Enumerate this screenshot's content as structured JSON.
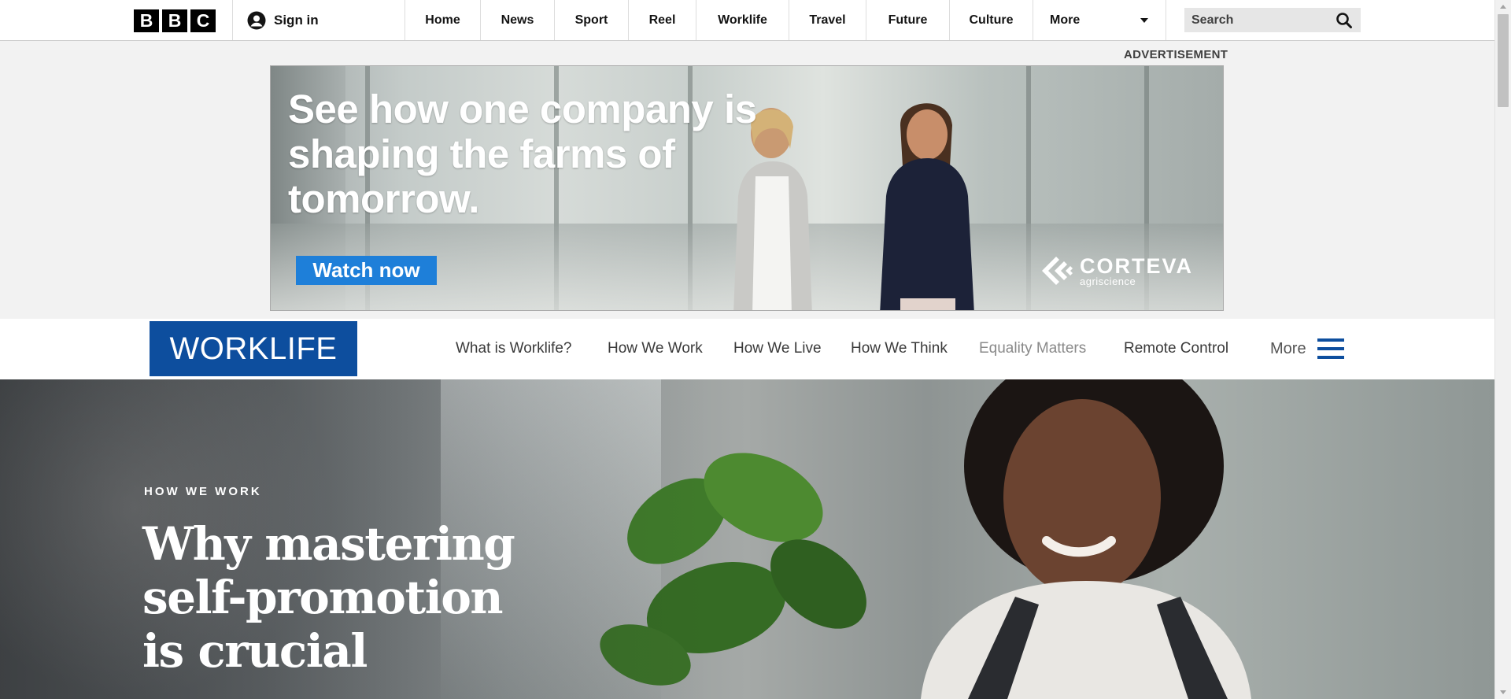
{
  "global_nav": {
    "logo_letters": [
      "B",
      "B",
      "C"
    ],
    "sign_in": "Sign in",
    "items": [
      {
        "label": "Home"
      },
      {
        "label": "News"
      },
      {
        "label": "Sport"
      },
      {
        "label": "Reel"
      },
      {
        "label": "Worklife"
      },
      {
        "label": "Travel"
      },
      {
        "label": "Future"
      },
      {
        "label": "Culture"
      }
    ],
    "more_label": "More",
    "search_placeholder": "Search"
  },
  "advertisement": {
    "label": "ADVERTISEMENT",
    "headline": "See how one company is shaping the farms of tomorrow.",
    "cta": "Watch now",
    "brand_name": "CORTEVA",
    "brand_sub": "agriscience",
    "cta_color": "#1e7fd9"
  },
  "worklife_nav": {
    "logo": "WORKLIFE",
    "brand_color": "#0d4e9e",
    "items": [
      {
        "label": "What is Worklife?"
      },
      {
        "label": "How We Work"
      },
      {
        "label": "How We Live"
      },
      {
        "label": "How We Think"
      },
      {
        "label": "Equality Matters"
      },
      {
        "label": "Remote Control"
      }
    ],
    "more_label": "More"
  },
  "hero": {
    "kicker": "HOW WE WORK",
    "title": "Why mastering self-promotion is crucial"
  }
}
